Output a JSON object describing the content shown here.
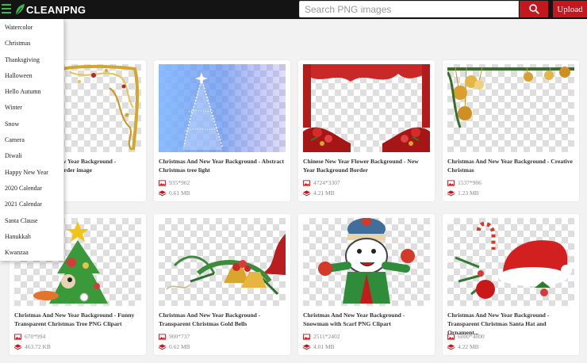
{
  "header": {
    "logo_text": "CLEANPNG",
    "search_placeholder": "Search PNG images",
    "upload_label": "Upload"
  },
  "menu": {
    "items": [
      "Watercolor",
      "Christmas",
      "Thanksgiving",
      "Halloween",
      "Hello Autumn",
      "Winter",
      "Snow",
      "Camera",
      "Diwali",
      "Happy New Year",
      "2020 Calendar",
      "2021 Calendar",
      "Santa Clause",
      "Hanukkah",
      "Kwanzaa"
    ]
  },
  "cards": [
    {
      "title": "Christmas And New Year Background - Christmas Gold Border image",
      "dimensions": "",
      "size": ""
    },
    {
      "title": "Christmas And New Year Background - Abstract Christmas tree light",
      "dimensions": "935*902",
      "size": "0.61 MB"
    },
    {
      "title": "Chinese New Year Flower Background - New Year Background Border",
      "dimensions": "4724*3307",
      "size": "4.21 MB"
    },
    {
      "title": "Christmas And New Year Background - Creative Christmas",
      "dimensions": "1537*906",
      "size": "1.23 MB"
    },
    {
      "title": "Christmas And New Year Background - Funny Transparent Christmas Tree PNG Clipart",
      "dimensions": "670*994",
      "size": "463.72 KB"
    },
    {
      "title": "Christmas And New Year Background - Transparent Christmas Gold Bells",
      "dimensions": "900*737",
      "size": "0.62 MB"
    },
    {
      "title": "Christmas And New Year Background - Snowman with Scarf PNG Clipart",
      "dimensions": "2511*2402",
      "size": "4.01 MB"
    },
    {
      "title": "Christmas And New Year Background - Transparent Christmas Santa Hat and Ornament...",
      "dimensions": "6000*4000",
      "size": "4.22 MB"
    }
  ],
  "colors": {
    "accent": "#c5171e",
    "brand_green": "#3fb74f",
    "topbar": "#141414"
  },
  "icons": {
    "menu": "hamburger-menu-icon",
    "search": "search-icon",
    "dimensions": "image-icon",
    "size": "layers-icon"
  }
}
